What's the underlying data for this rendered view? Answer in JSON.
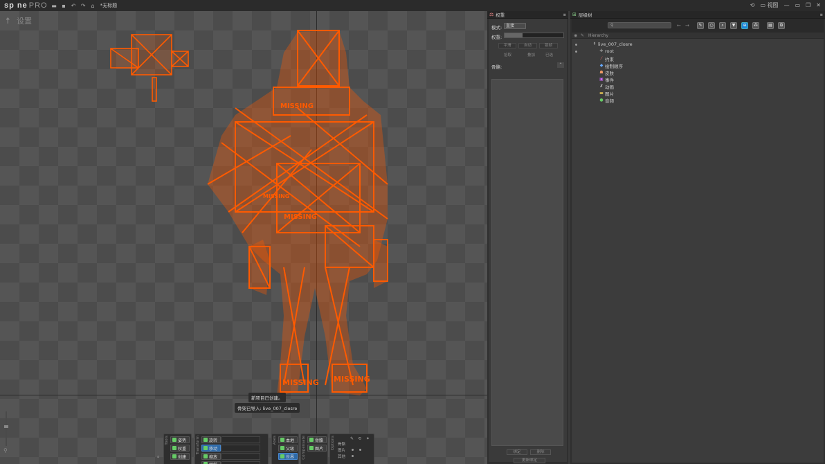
{
  "app": {
    "logo": "sp ne",
    "logo_pro": "PRO",
    "doc_title": "*无标题",
    "view_menu": "视图"
  },
  "viewport": {
    "mode_label": "设置"
  },
  "toasts": [
    "新项目已创建。",
    "骨架已导入: live_007_closre"
  ],
  "tools": {
    "label": "Tools",
    "items": [
      "姿势",
      "权重",
      "创建"
    ],
    "selected": "权重"
  },
  "transform": {
    "label": "Transform",
    "items": [
      "旋转",
      "移动",
      "缩放",
      "倾斜"
    ],
    "selected": "移动"
  },
  "axes": {
    "label": "Axes",
    "items": [
      "本地",
      "父级",
      "世界"
    ],
    "selected": "世界"
  },
  "compensate": {
    "label": "Compensate",
    "items": [
      "骨骼",
      "图片"
    ]
  },
  "options": {
    "label": "Options",
    "items": [
      "骨骼",
      "图片",
      "其他"
    ]
  },
  "weights": {
    "title": "权重",
    "mode_label": "模式:",
    "mode_value": "直接",
    "weight_label": "权重:",
    "weight_value": 0.3,
    "buttons": [
      "平滑",
      "自动",
      "锁帧"
    ],
    "buttons2": [
      "拾取",
      "叠加",
      "已选"
    ],
    "bones_label": "骨骼:",
    "footer": [
      "绑定",
      "删除",
      "更新绑定"
    ]
  },
  "tree": {
    "title": "层级树",
    "search_placeholder": "",
    "header": "Hierarchy",
    "nodes": [
      {
        "label": "live_007_closre",
        "icon": "skeleton-icon",
        "level": 0
      },
      {
        "label": "root",
        "icon": "bone-icon",
        "level": 1
      },
      {
        "label": "约束",
        "icon": "constraint-icon",
        "level": 1
      },
      {
        "label": "绘制顺序",
        "icon": "draw-order-icon",
        "level": 1
      },
      {
        "label": "皮肤",
        "icon": "skin-icon",
        "level": 1
      },
      {
        "label": "事件",
        "icon": "event-icon",
        "level": 1
      },
      {
        "label": "动画",
        "icon": "animation-icon",
        "level": 1
      },
      {
        "label": "图片",
        "icon": "images-icon",
        "level": 1
      },
      {
        "label": "音频",
        "icon": "audio-icon",
        "level": 1
      }
    ]
  },
  "colors": {
    "accent": "#ff5a00",
    "selected": "#2e6aa8",
    "filter_on": "#1e88d8"
  }
}
